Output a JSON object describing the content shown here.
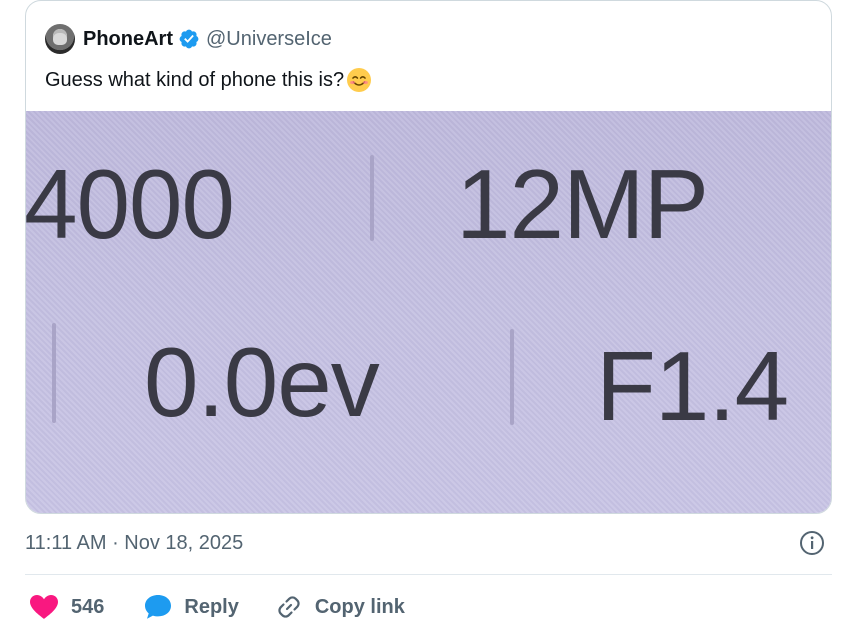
{
  "author": {
    "display_name": "PhoneArt",
    "handle": "@UniverseIce",
    "verified_color": "#1d9bf0"
  },
  "tweet": {
    "text": "Guess what kind of phone this is?",
    "emoji": "smiling-face-icon"
  },
  "photo": {
    "labels": [
      "4000",
      "12MP",
      "0.0ev",
      "F1.4"
    ],
    "background": "#c0bce0"
  },
  "meta": {
    "timestamp": "11:11 AM · Nov 18, 2025"
  },
  "actions": {
    "like_count": "546",
    "reply_label": "Reply",
    "copy_label": "Copy link",
    "like_color": "#f91880",
    "reply_color": "#1d9bf0"
  }
}
